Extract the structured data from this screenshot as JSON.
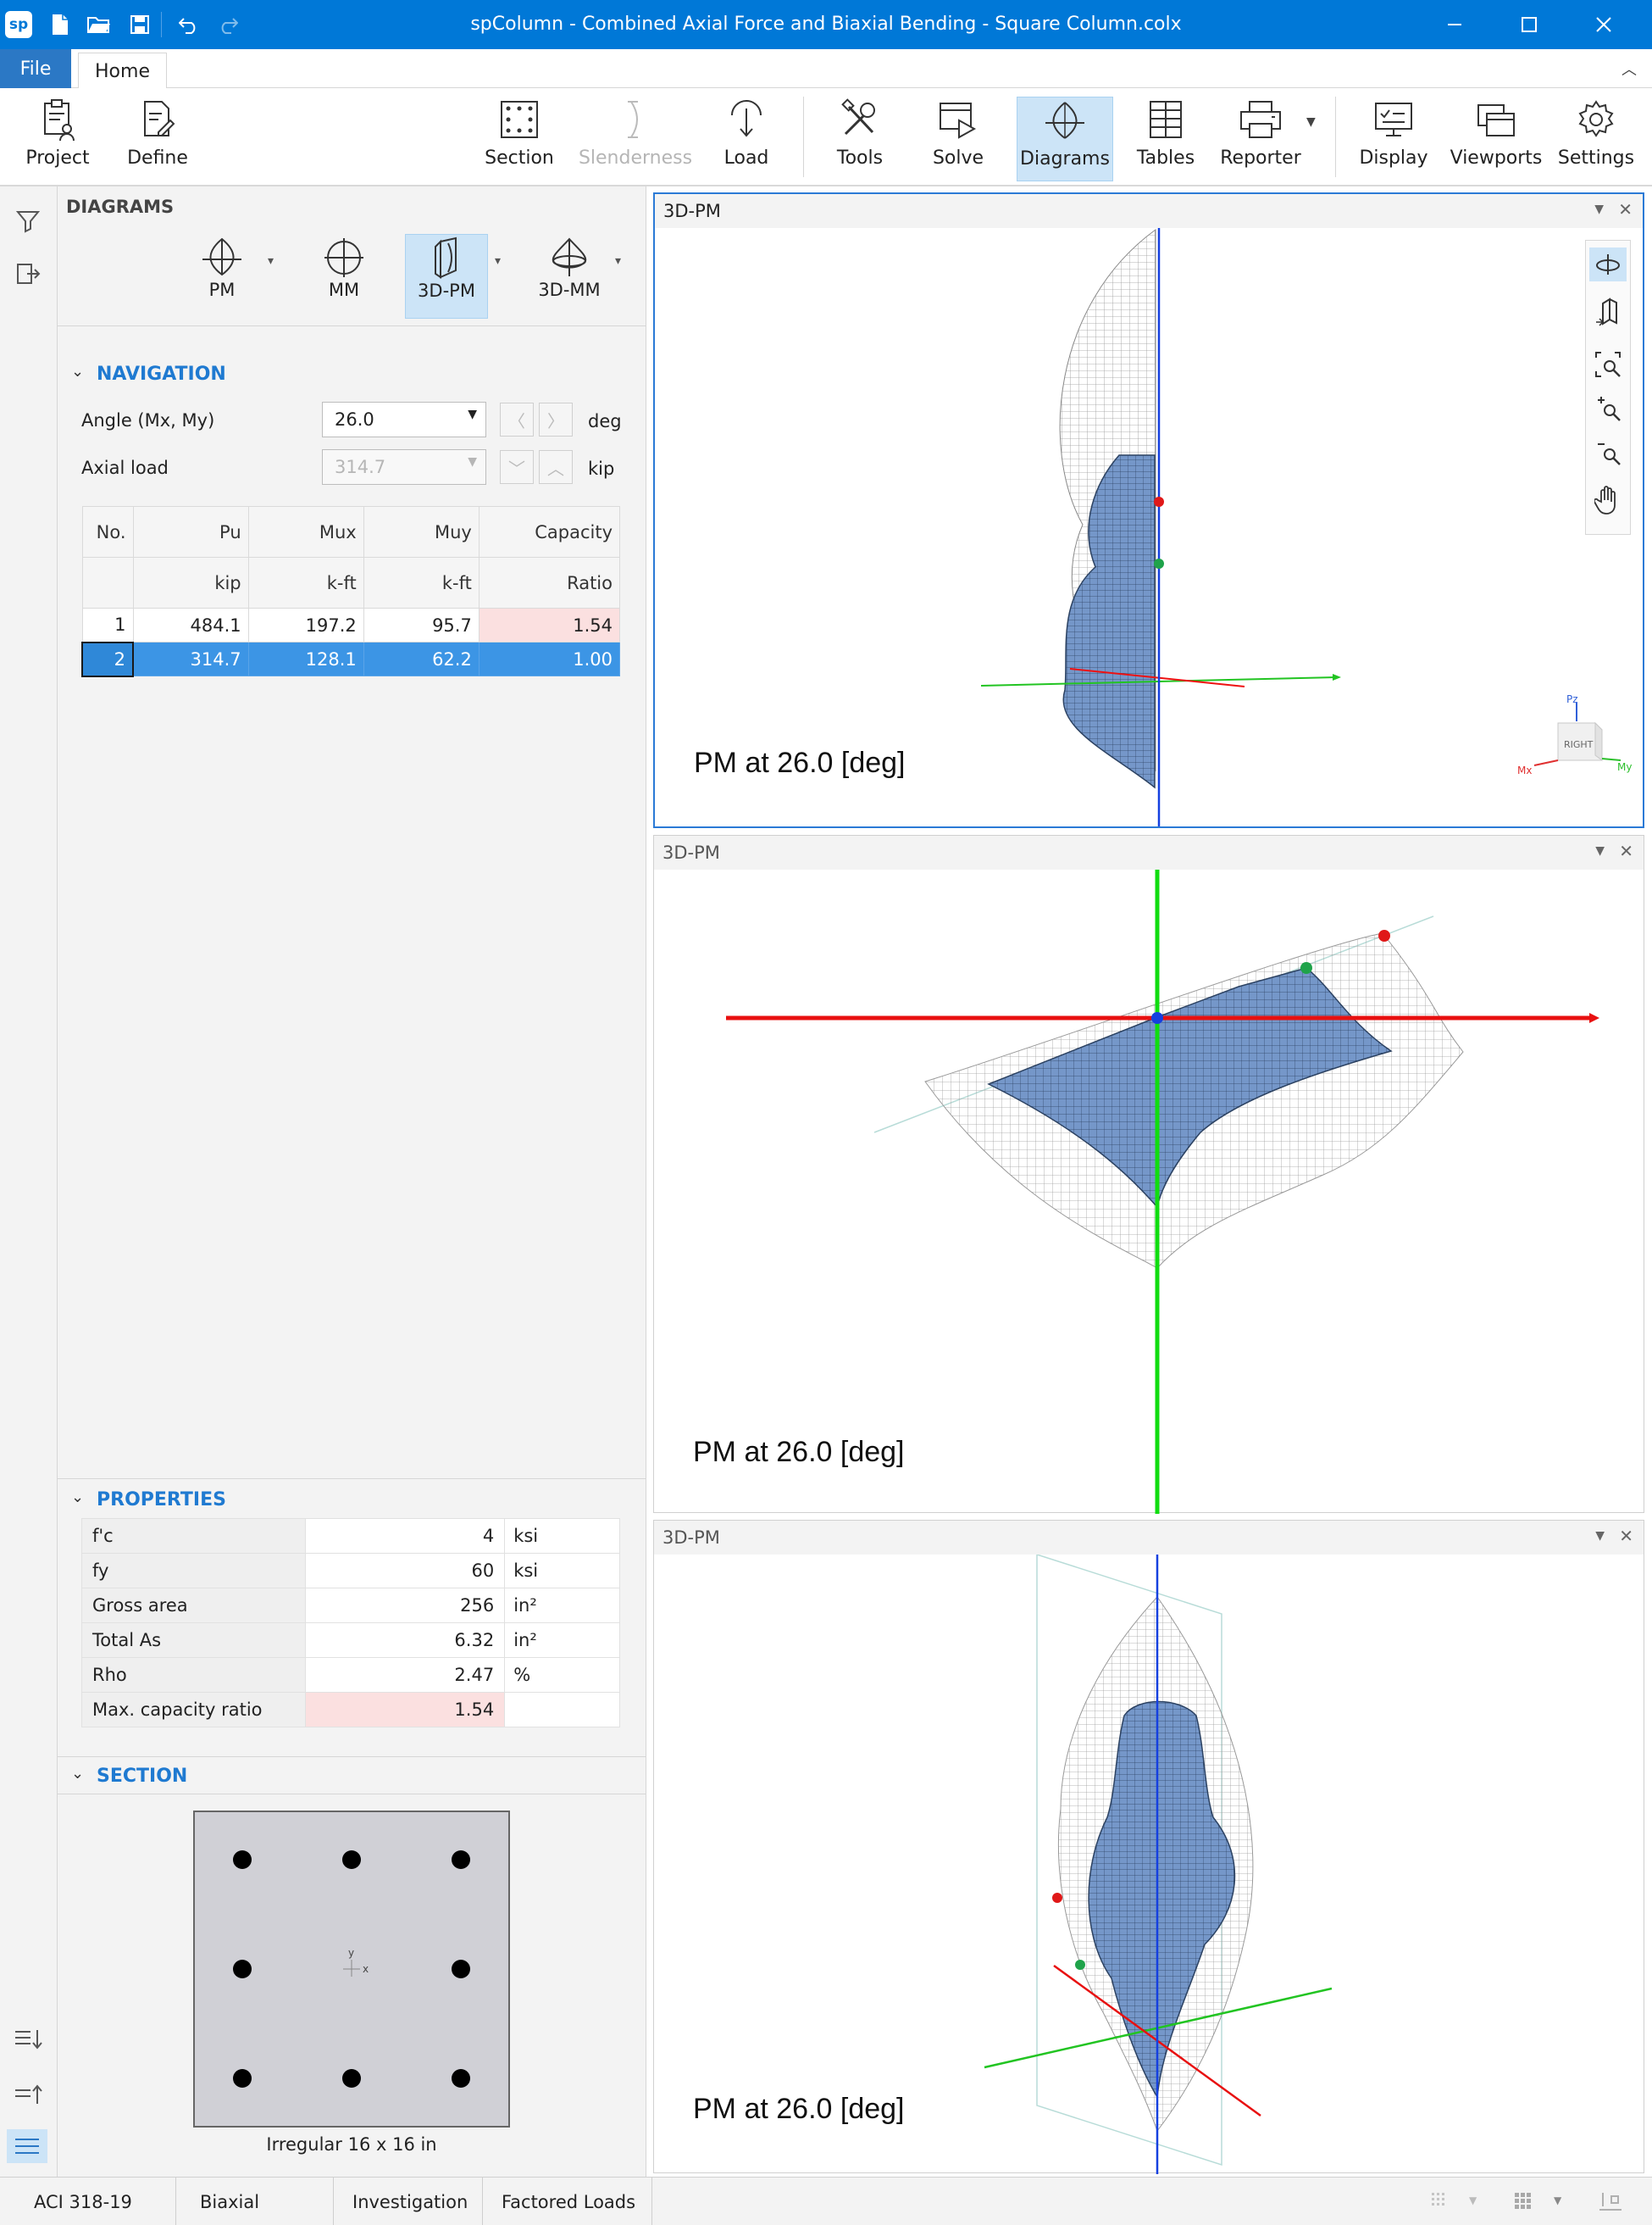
{
  "window": {
    "title": "spColumn - Combined Axial Force and Biaxial Bending - Square Column.colx",
    "app_badge": "sp",
    "quick_access": [
      "new-file-icon",
      "open-folder-icon",
      "save-icon",
      "undo-icon",
      "redo-icon"
    ],
    "controls": [
      "minimize-icon",
      "maximize-icon",
      "close-icon"
    ]
  },
  "tabs": {
    "file": "File",
    "home": "Home"
  },
  "ribbon": {
    "buttons": [
      {
        "id": "project",
        "label": "Project",
        "icon": "clipboard-person-icon"
      },
      {
        "id": "define",
        "label": "Define",
        "icon": "document-pencil-icon"
      },
      {
        "id": "section",
        "label": "Section",
        "icon": "section-dots-icon"
      },
      {
        "id": "slenderness",
        "label": "Slenderness",
        "icon": "slenderness-icon",
        "disabled": true
      },
      {
        "id": "load",
        "label": "Load",
        "icon": "load-arrow-icon"
      },
      {
        "id": "tools",
        "label": "Tools",
        "icon": "tools-icon"
      },
      {
        "id": "solve",
        "label": "Solve",
        "icon": "solve-play-icon"
      },
      {
        "id": "diagrams",
        "label": "Diagrams",
        "icon": "diagram-icon",
        "active": true
      },
      {
        "id": "tables",
        "label": "Tables",
        "icon": "table-icon"
      },
      {
        "id": "reporter",
        "label": "Reporter",
        "icon": "printer-icon"
      },
      {
        "id": "display",
        "label": "Display",
        "icon": "display-icon"
      },
      {
        "id": "viewports",
        "label": "Viewports",
        "icon": "viewports-icon"
      },
      {
        "id": "settings",
        "label": "Settings",
        "icon": "gear-icon"
      }
    ]
  },
  "panel": {
    "title": "DIAGRAMS",
    "diagram_types": [
      {
        "label": "PM",
        "icon": "pm-diagram-icon"
      },
      {
        "label": "MM",
        "icon": "mm-diagram-icon"
      },
      {
        "label": "3D-PM",
        "icon": "3d-pm-diagram-icon",
        "active": true
      },
      {
        "label": "3D-MM",
        "icon": "3d-mm-diagram-icon"
      }
    ],
    "navigation": {
      "header": "NAVIGATION",
      "angle_label": "Angle (Mx, My)",
      "angle_value": "26.0",
      "angle_unit": "deg",
      "axial_label": "Axial load",
      "axial_value": "314.7",
      "axial_unit": "kip"
    },
    "load_table": {
      "headers": [
        "No.",
        "Pu",
        "Mux",
        "Muy",
        "Capacity"
      ],
      "units": [
        "",
        "kip",
        "k-ft",
        "k-ft",
        "Ratio"
      ],
      "rows": [
        [
          "1",
          "484.1",
          "197.2",
          "95.7",
          "1.54"
        ],
        [
          "2",
          "314.7",
          "128.1",
          "62.2",
          "1.00"
        ]
      ],
      "selected_row": 2
    },
    "properties": {
      "header": "PROPERTIES",
      "rows": [
        {
          "name": "f'c",
          "value": "4",
          "unit": "ksi"
        },
        {
          "name": "fy",
          "value": "60",
          "unit": "ksi"
        },
        {
          "name": "Gross area",
          "value": "256",
          "unit": "in²"
        },
        {
          "name": "Total As",
          "value": "6.32",
          "unit": "in²"
        },
        {
          "name": "Rho",
          "value": "2.47",
          "unit": "%"
        },
        {
          "name": "Max. capacity ratio",
          "value": "1.54",
          "unit": ""
        }
      ]
    },
    "section": {
      "header": "SECTION",
      "caption": "Irregular 16 x 16 in",
      "axis_x": "x",
      "axis_y": "y"
    }
  },
  "viewports": [
    {
      "title": "3D-PM",
      "caption": "PM at 26.0 [deg]",
      "selected": true
    },
    {
      "title": "3D-PM",
      "caption": "PM at 26.0 [deg]"
    },
    {
      "title": "3D-PM",
      "caption": "PM at 26.0 [deg]"
    }
  ],
  "view_tools": [
    "rotate-icon",
    "pan-3d-icon",
    "zoom-extents-icon",
    "zoom-in-icon",
    "zoom-out-icon",
    "pan-hand-icon"
  ],
  "nav_cube": {
    "face": "RIGHT",
    "axis_pz": "Pz",
    "axis_mx": "Mx",
    "axis_my": "My"
  },
  "status_bar": [
    "ACI 318-19",
    "Biaxial",
    "Investigation",
    "Factored Loads"
  ],
  "colors": {
    "accent": "#0078d7",
    "selected_row": "#3c95e5",
    "surface": "#6f93c8"
  }
}
